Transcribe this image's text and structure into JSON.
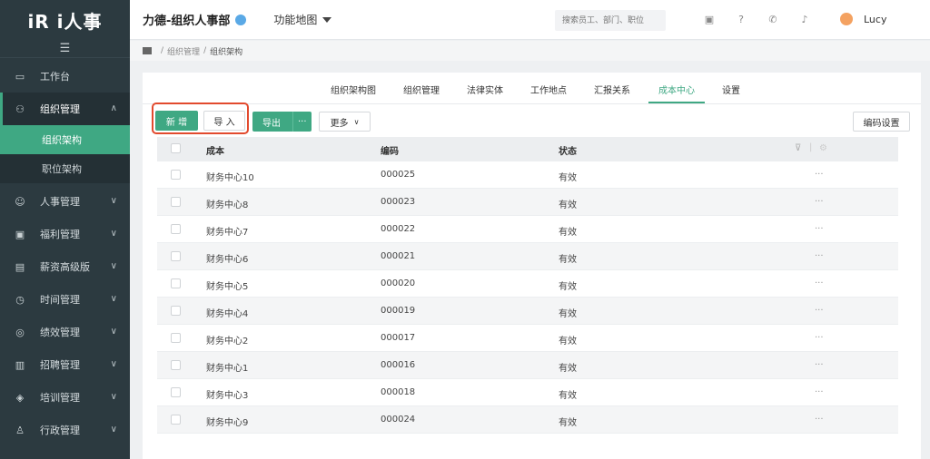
{
  "brand": {
    "logo_text": "iR i人事"
  },
  "sidebar": {
    "collapse_icon": "menu-icon",
    "items": [
      {
        "label": "工作台",
        "icon": "monitor-icon"
      },
      {
        "label": "组织管理",
        "icon": "org-icon",
        "open": true,
        "subitems": [
          {
            "label": "组织架构",
            "active": true
          },
          {
            "label": "职位架构"
          }
        ]
      },
      {
        "label": "人事管理",
        "icon": "user-icon"
      },
      {
        "label": "福利管理",
        "icon": "gift-icon"
      },
      {
        "label": "薪资高级版",
        "icon": "wallet-icon"
      },
      {
        "label": "时间管理",
        "icon": "clock-icon"
      },
      {
        "label": "绩效管理",
        "icon": "target-icon"
      },
      {
        "label": "招聘管理",
        "icon": "briefcase-icon"
      },
      {
        "label": "培训管理",
        "icon": "layers-icon"
      },
      {
        "label": "行政管理",
        "icon": "admin-icon"
      }
    ]
  },
  "header": {
    "company": "力德-组织人事部",
    "function_map": "功能地图",
    "search_placeholder": "搜索员工、部门、职位",
    "user_name": "Lucy"
  },
  "breadcrumb": [
    "组织管理",
    "组织架构"
  ],
  "tabs": [
    {
      "label": "组织架构图"
    },
    {
      "label": "组织管理"
    },
    {
      "label": "法律实体"
    },
    {
      "label": "工作地点"
    },
    {
      "label": "汇报关系"
    },
    {
      "label": "成本中心",
      "active": true
    },
    {
      "label": "设置"
    }
  ],
  "toolbar": {
    "add_label": "新 增",
    "import_label": "导 入",
    "export_label": "导出",
    "export_more": "···",
    "more_label": "更多",
    "code_settings_label": "编码设置"
  },
  "table": {
    "columns": [
      "成本",
      "编码",
      "状态"
    ],
    "rows": [
      {
        "name": "财务中心10",
        "code": "000025",
        "status": "有效"
      },
      {
        "name": "财务中心8",
        "code": "000023",
        "status": "有效"
      },
      {
        "name": "财务中心7",
        "code": "000022",
        "status": "有效"
      },
      {
        "name": "财务中心6",
        "code": "000021",
        "status": "有效"
      },
      {
        "name": "财务中心5",
        "code": "000020",
        "status": "有效"
      },
      {
        "name": "财务中心4",
        "code": "000019",
        "status": "有效"
      },
      {
        "name": "财务中心2",
        "code": "000017",
        "status": "有效"
      },
      {
        "name": "财务中心1",
        "code": "000016",
        "status": "有效"
      },
      {
        "name": "财务中心3",
        "code": "000018",
        "status": "有效"
      },
      {
        "name": "财务中心9",
        "code": "000024",
        "status": "有效"
      }
    ],
    "row_action": "···"
  },
  "colors": {
    "accent": "#3fa883",
    "sidebar": "#2c3a40",
    "highlight": "#e24a2e"
  }
}
